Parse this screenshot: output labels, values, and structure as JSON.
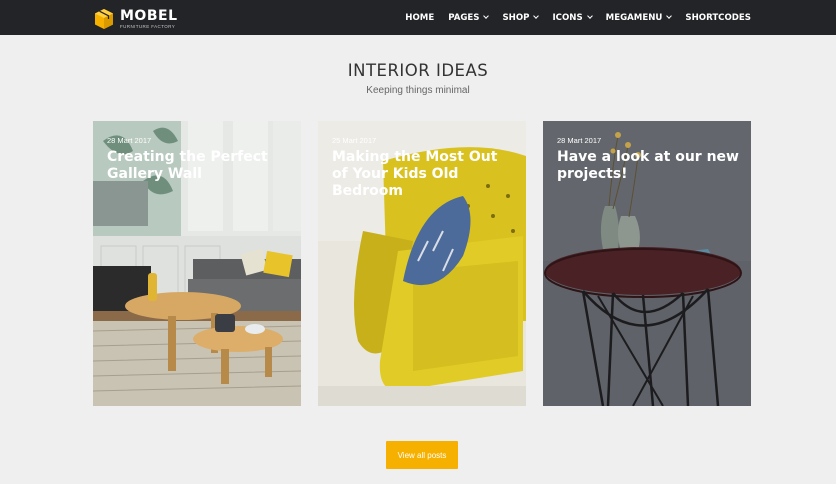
{
  "brand": {
    "name": "MOBEL",
    "tagline": "FURNITURE FACTORY",
    "logo_icon": "box-icon",
    "accent": "#f6b100"
  },
  "nav": {
    "background": "#232427",
    "items": [
      {
        "label": "HOME",
        "dropdown": false
      },
      {
        "label": "PAGES",
        "dropdown": true
      },
      {
        "label": "SHOP",
        "dropdown": true
      },
      {
        "label": "ICONS",
        "dropdown": true
      },
      {
        "label": "MEGAMENU",
        "dropdown": true
      },
      {
        "label": "SHORTCODES",
        "dropdown": false
      }
    ]
  },
  "section": {
    "title": "INTERIOR IDEAS",
    "subtitle": "Keeping things minimal"
  },
  "posts": [
    {
      "date": "28 Mart 2017",
      "title": "Creating the Perfect Gallery Wall",
      "image": "living-room-coffee-table"
    },
    {
      "date": "25 Mart 2017",
      "title": "Making the Most Out of Your Kids Old Bedroom",
      "image": "yellow-armchair-with-pillow"
    },
    {
      "date": "28 Mart 2017",
      "title": "Have a look at our new projects!",
      "image": "side-table-with-book-and-vases"
    }
  ],
  "cta": {
    "label": "View all posts"
  }
}
